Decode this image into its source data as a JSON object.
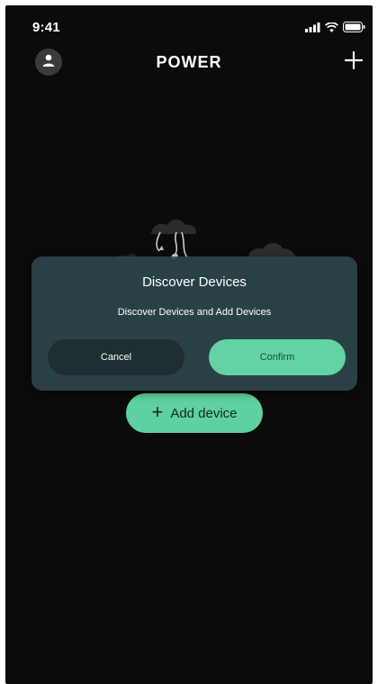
{
  "status_bar": {
    "time": "9:41",
    "icons": [
      "signal-icon",
      "wifi-icon",
      "battery-icon"
    ]
  },
  "header": {
    "title": "POWER",
    "left_icon": "user-icon",
    "right_icon": "plus-icon"
  },
  "main": {
    "add_device_label": "Add device",
    "add_device_icon": "plus-icon"
  },
  "dialog": {
    "title": "Discover Devices",
    "message": "Discover Devices and Add Devices",
    "cancel_label": "Cancel",
    "confirm_label": "Confirm"
  },
  "colors": {
    "background": "#0b0b0b",
    "accent": "#5fd0a0",
    "dialog_bg": "#2c464a",
    "cancel_bg": "#1f2e30"
  }
}
